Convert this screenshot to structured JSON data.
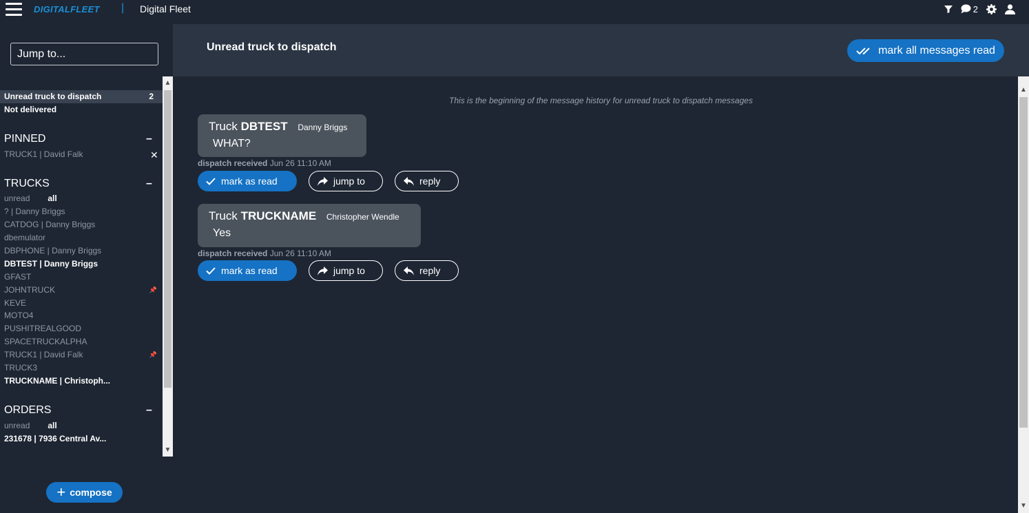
{
  "topbar": {
    "brand": "DIGITALFLEET",
    "separator": "|",
    "app_title": "Digital Fleet",
    "message_count": "2"
  },
  "sidebar": {
    "jump_placeholder": "Jump to...",
    "top_items": [
      {
        "label": "Unread truck to dispatch",
        "count": "2"
      },
      {
        "label": "Not delivered"
      }
    ],
    "pinned": {
      "title": "PINNED",
      "collapse": "–",
      "items": [
        {
          "label": "TRUCK1 | David Falk",
          "remove": "✕"
        }
      ]
    },
    "trucks": {
      "title": "TRUCKS",
      "collapse": "–",
      "filter_unread": "unread",
      "filter_all": "all",
      "items": [
        {
          "label": "? | Danny Briggs"
        },
        {
          "label": "CATDOG | Danny Briggs"
        },
        {
          "label": "dbemulator"
        },
        {
          "label": "DBPHONE | Danny Briggs"
        },
        {
          "label": "DBTEST | Danny Briggs"
        },
        {
          "label": "GFAST"
        },
        {
          "label": "JOHNTRUCK"
        },
        {
          "label": "KEVE"
        },
        {
          "label": "MOTO4"
        },
        {
          "label": "PUSHITREALGOOD"
        },
        {
          "label": "SPACETRUCKALPHA"
        },
        {
          "label": "TRUCK1 | David Falk"
        },
        {
          "label": "TRUCK3"
        },
        {
          "label": "TRUCKNAME | Christoph..."
        }
      ]
    },
    "orders": {
      "title": "ORDERS",
      "collapse": "–",
      "filter_unread": "unread",
      "filter_all": "all",
      "items": [
        {
          "label": "231678 | 7936 Central Av..."
        }
      ]
    },
    "compose_label": "compose"
  },
  "main": {
    "title": "Unread truck to dispatch",
    "mark_all_label": "mark all messages read",
    "history_note": "This is the beginning of the message history for unread truck to dispatch messages",
    "messages": [
      {
        "truck_prefix": "Truck",
        "truck_name": "DBTEST",
        "driver": "Danny Briggs",
        "text": "WHAT?",
        "status": "dispatch received",
        "time": "Jun 26 11:10 AM",
        "mark_read_label": "mark as read",
        "jump_label": "jump to",
        "reply_label": "reply"
      },
      {
        "truck_prefix": "Truck",
        "truck_name": "TRUCKNAME",
        "driver": "Christopher Wendle",
        "text": "Yes",
        "status": "dispatch received",
        "time": "Jun 26 11:10 AM",
        "mark_read_label": "mark as read",
        "jump_label": "jump to",
        "reply_label": "reply"
      }
    ]
  },
  "colors": {
    "background": "#1e2633",
    "header": "#2b3543",
    "accent": "#1572c4",
    "brand": "#1a8fd6",
    "bubble": "#4b535d"
  }
}
